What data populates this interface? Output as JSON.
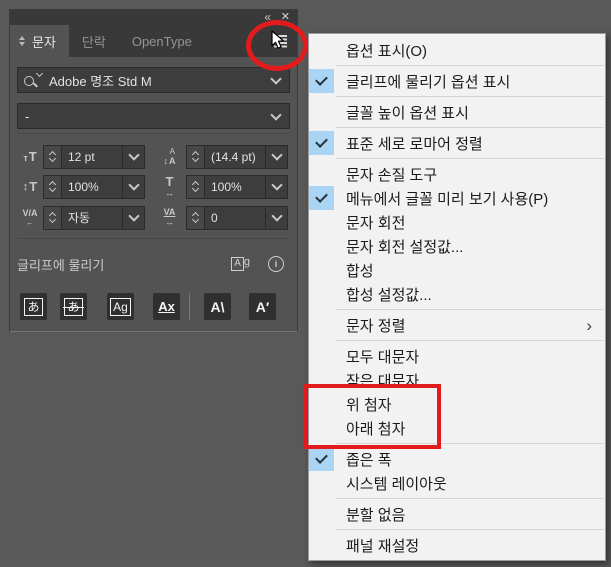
{
  "window": {
    "collapse_icon": "«",
    "close_icon": "✕"
  },
  "panel": {
    "tabs": [
      {
        "label": "문자",
        "active": true
      },
      {
        "label": "단락",
        "active": false
      },
      {
        "label": "OpenType",
        "active": false
      }
    ],
    "font_family": "Adobe 명조 Std M",
    "font_style": "-",
    "fields": {
      "size": {
        "value": "12 pt"
      },
      "leading": {
        "value": "(14.4 pt)"
      },
      "vertical_scale": {
        "value": "100%"
      },
      "horizontal_scale": {
        "value": "100%"
      },
      "kerning": {
        "value": "자동"
      },
      "tracking": {
        "value": "0"
      }
    },
    "field_icons": {
      "size": {
        "a": "т",
        "b": "T"
      },
      "leading": {
        "a": "↕",
        "b": "A",
        "c": "A"
      },
      "vertical_scale": {
        "a": "↕",
        "b": "T"
      },
      "horizontal_scale": {
        "b": "T",
        "c": "↔"
      },
      "kerning": {
        "b": "V/A",
        "c": "←"
      },
      "tracking": {
        "b": "VA",
        "c": "↔"
      }
    },
    "snap_section": {
      "label": "글리프에 물리기",
      "ag_icon_a": "A",
      "ag_icon_b": "g",
      "info_glyph": "i"
    },
    "snap_buttons": [
      {
        "name": "snap-embox",
        "glyph": "あ"
      },
      {
        "name": "snap-embox-center",
        "glyph": "あ"
      },
      {
        "name": "snap-glyph-bounds",
        "glyph": "Ag"
      },
      {
        "name": "snap-baseline",
        "glyph": "Ax"
      },
      {
        "name": "snap-angle",
        "glyph": "A\\"
      },
      {
        "name": "snap-rotate",
        "glyph": "A′"
      }
    ]
  },
  "menu": {
    "submenu_arrow": "›",
    "items": [
      {
        "label": "옵션 표시(O)",
        "checked": false
      },
      {
        "label": "글리프에 물리기 옵션 표시",
        "checked": true
      },
      {
        "label": "글꼴 높이 옵션 표시",
        "checked": false
      },
      {
        "label": "표준 세로 로마어 정렬",
        "checked": true
      },
      {
        "label": "문자 손질 도구",
        "checked": false
      },
      {
        "label": "메뉴에서 글꼴 미리 보기 사용(P)",
        "checked": true
      },
      {
        "label": "문자 회전",
        "checked": false
      },
      {
        "label": "문자 회전 설정값...",
        "checked": false
      },
      {
        "label": "합성",
        "checked": false
      },
      {
        "label": "합성 설정값...",
        "checked": false
      },
      {
        "label": "문자 정렬",
        "checked": false,
        "submenu": true
      },
      {
        "label": "모두 대문자",
        "checked": false
      },
      {
        "label": "작은 대문자",
        "checked": false
      },
      {
        "label": "위 첨자",
        "checked": false,
        "annotated": true
      },
      {
        "label": "아래 첨자",
        "checked": false,
        "annotated": true
      },
      {
        "label": "좁은 폭",
        "checked": true
      },
      {
        "label": "시스템 레이아웃",
        "checked": false
      },
      {
        "label": "분할 없음",
        "checked": false
      },
      {
        "label": "패널 재설정",
        "checked": false
      }
    ]
  },
  "colors": {
    "annotation_red": "#e21c1c",
    "check_blue": "#a9d4f4",
    "panel_bg": "#535353",
    "menu_bg": "#f2f2f2",
    "canvas_bg": "#595959"
  }
}
